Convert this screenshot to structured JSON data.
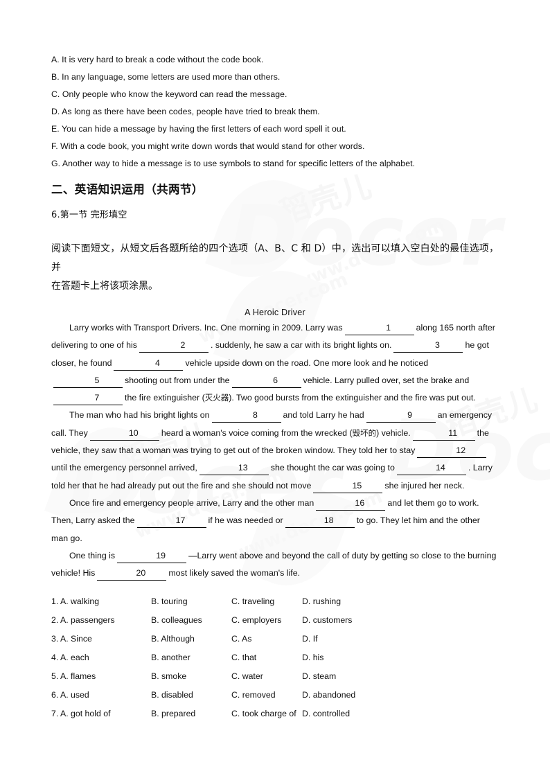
{
  "document": {
    "page_background": "#ffffff",
    "text_color": "#111111"
  },
  "watermark": {
    "chinese": "稻壳儿",
    "brand": "Docer",
    "url": "www.docer.com"
  },
  "lead_options": {
    "items": [
      "A. It is very hard to break a code without the code book.",
      "B. In any language, some letters are used more than others.",
      "C. Only people who know the keyword can read the message.",
      "D. As long as there have been codes, people have tried to break them.",
      "E. You can hide a message by having the first letters of each word spell it out.",
      "F. With a code book, you might write down words that would stand for other words.",
      "G. Another way to hide a message is to use symbols to stand for specific letters of the alphabet."
    ]
  },
  "section": {
    "heading": "二、英语知识运用（共两节）",
    "subsection": "6.第一节 完形填空",
    "instructions_line1": "阅读下面短文，从短文后各题所给的四个选项（A、B、C 和 D）中，选出可以填入空白处的最佳选项，并",
    "instructions_line2": "在答题卡上将该项涂黑。"
  },
  "passage": {
    "title": "A Heroic Driver",
    "p1": {
      "s1": "Larry works with Transport Drivers. Inc. One morning in 2009. Larry was",
      "blank1": "1",
      "s2": "along 165 north after delivering to one of his",
      "blank2": "2",
      "s3": ". suddenly, he saw a car with its bright lights on.",
      "blank3": "3",
      "s4": "he got closer, he found",
      "blank4": "4",
      "s5": "vehicle upside down on the road. One more look and he noticed",
      "blank5": "5",
      "s6": "shooting out from under the",
      "blank6": "6",
      "s7": "vehicle. Larry pulled over, set the brake and",
      "blank7": "7",
      "s8": "the fire extinguisher (",
      "gloss1": "灭火器",
      "s9": "). Two good bursts from the extinguisher and the fire was put out."
    },
    "p2": {
      "s1": "The man who had his bright lights on",
      "blank8": "8",
      "s2": "and told Larry he had",
      "blank9": "9",
      "s3": "an emergency call. They",
      "blank10": "10",
      "s4": "heard a woman's voice coming from the wrecked (",
      "gloss2": "毁坏的",
      "s5": ") vehicle.",
      "blank11": "11",
      "s6": "the vehicle, they saw that a woman was trying to get out of the broken window. They told her to stay",
      "blank12": "12",
      "s7": "until the emergency personnel arrived,",
      "blank13": "13",
      "s8": "she thought the car was going to",
      "blank14": "14",
      "s9": ". Larry told her that he had already put out the fire and she should not move",
      "blank15": "15",
      "s10": "she injured her neck."
    },
    "p3": {
      "s1": "Once fire and emergency people arrive, Larry and the other man",
      "blank16": "16",
      "s2": "and let them go to work. Then, Larry asked the",
      "blank17": "17",
      "s3": "if he was needed or",
      "blank18": "18",
      "s4": "to go. They let him and the other man go."
    },
    "p4": {
      "s1": "One thing is",
      "blank19": "19",
      "s2": "—Larry went above and beyond the call of duty by getting so close to the burning vehicle! His",
      "blank20": "20",
      "s3": "most likely saved the woman's life."
    }
  },
  "question_options": {
    "rows": [
      {
        "num": "1.",
        "a": "A. walking",
        "b": "B. touring",
        "c": "C. traveling",
        "d": "D. rushing"
      },
      {
        "num": "2.",
        "a": "A. passengers",
        "b": "B. colleagues",
        "c": "C. employers",
        "d": "D. customers"
      },
      {
        "num": "3.",
        "a": "A.   Since",
        "b": "B. Although",
        "c": "C. As",
        "d": "D. If"
      },
      {
        "num": "4.",
        "a": "A.   each",
        "b": "B. another",
        "c": "C. that",
        "d": "D. his"
      },
      {
        "num": "5.",
        "a": "A.   flames",
        "b": "B. smoke",
        "c": "C. water",
        "d": "D. steam"
      },
      {
        "num": "6.",
        "a": "A. used",
        "b": "B. disabled",
        "c": "C. removed",
        "d": "D. abandoned"
      },
      {
        "num": "7.",
        "a": "A. got hold of",
        "b": "B. prepared",
        "c": "C. took charge of",
        "d": "D. controlled"
      }
    ]
  }
}
